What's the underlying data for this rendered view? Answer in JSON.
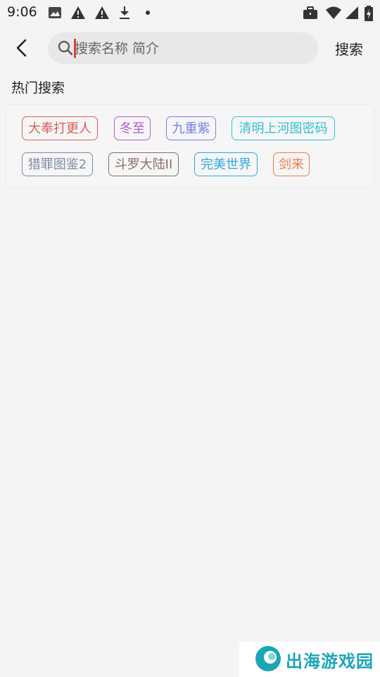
{
  "status_bar": {
    "time": "9:06",
    "icons": [
      "image-icon",
      "warning-icon",
      "warning-icon",
      "download-icon",
      "dot-icon",
      "briefcase-icon",
      "wifi-icon",
      "signal-icon",
      "battery-icon"
    ]
  },
  "header": {
    "search_placeholder": "搜索名称 简介",
    "search_value": "",
    "search_button_label": "搜索"
  },
  "hot_search": {
    "title": "热门搜索",
    "tags": [
      {
        "label": "大奉打更人",
        "color": "#e05a5a"
      },
      {
        "label": "冬至",
        "color": "#b35bd1"
      },
      {
        "label": "九重紫",
        "color": "#7a7ff0"
      },
      {
        "label": "清明上河图密码",
        "color": "#35c0d8"
      },
      {
        "label": "猎罪图鉴2",
        "color": "#7f8ca3"
      },
      {
        "label": "斗罗大陆II",
        "color": "#8a6d62"
      },
      {
        "label": "完美世界",
        "color": "#2fa8e6"
      },
      {
        "label": "剑来",
        "color": "#f07a4a"
      }
    ]
  },
  "watermark": {
    "text": "出海游戏园",
    "color": "#1aa6b7"
  }
}
